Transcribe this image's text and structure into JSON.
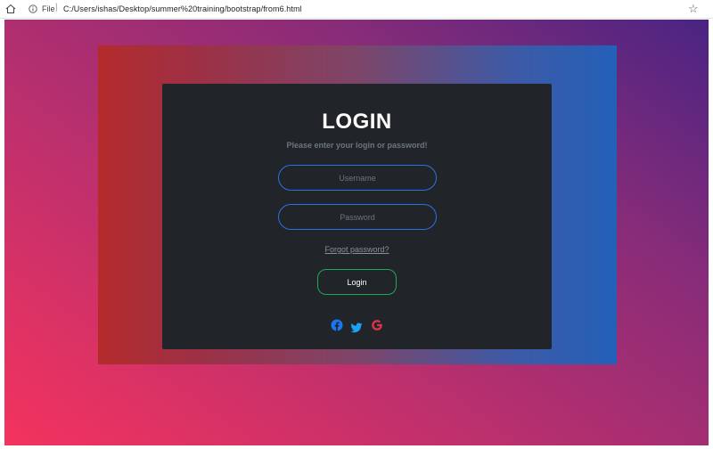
{
  "browser": {
    "scheme_label": "File",
    "separator": "|",
    "url": "C:/Users/ishas/Desktop/summer%20training/bootstrap/from6.html",
    "star": "☆"
  },
  "login": {
    "title": "LOGIN",
    "subtitle": "Please enter your login or password!",
    "username_placeholder": "Username",
    "password_placeholder": "Password",
    "forgot_link": "Forgot password?",
    "login_button": "Login"
  },
  "colors": {
    "card_bg": "#212529",
    "input_border": "#2d6fe0",
    "button_border": "#20a85a",
    "facebook": "#1877f2",
    "twitter": "#1da1f2",
    "google": "#dc3545"
  },
  "social_icons": [
    "facebook-icon",
    "twitter-icon",
    "google-icon"
  ]
}
